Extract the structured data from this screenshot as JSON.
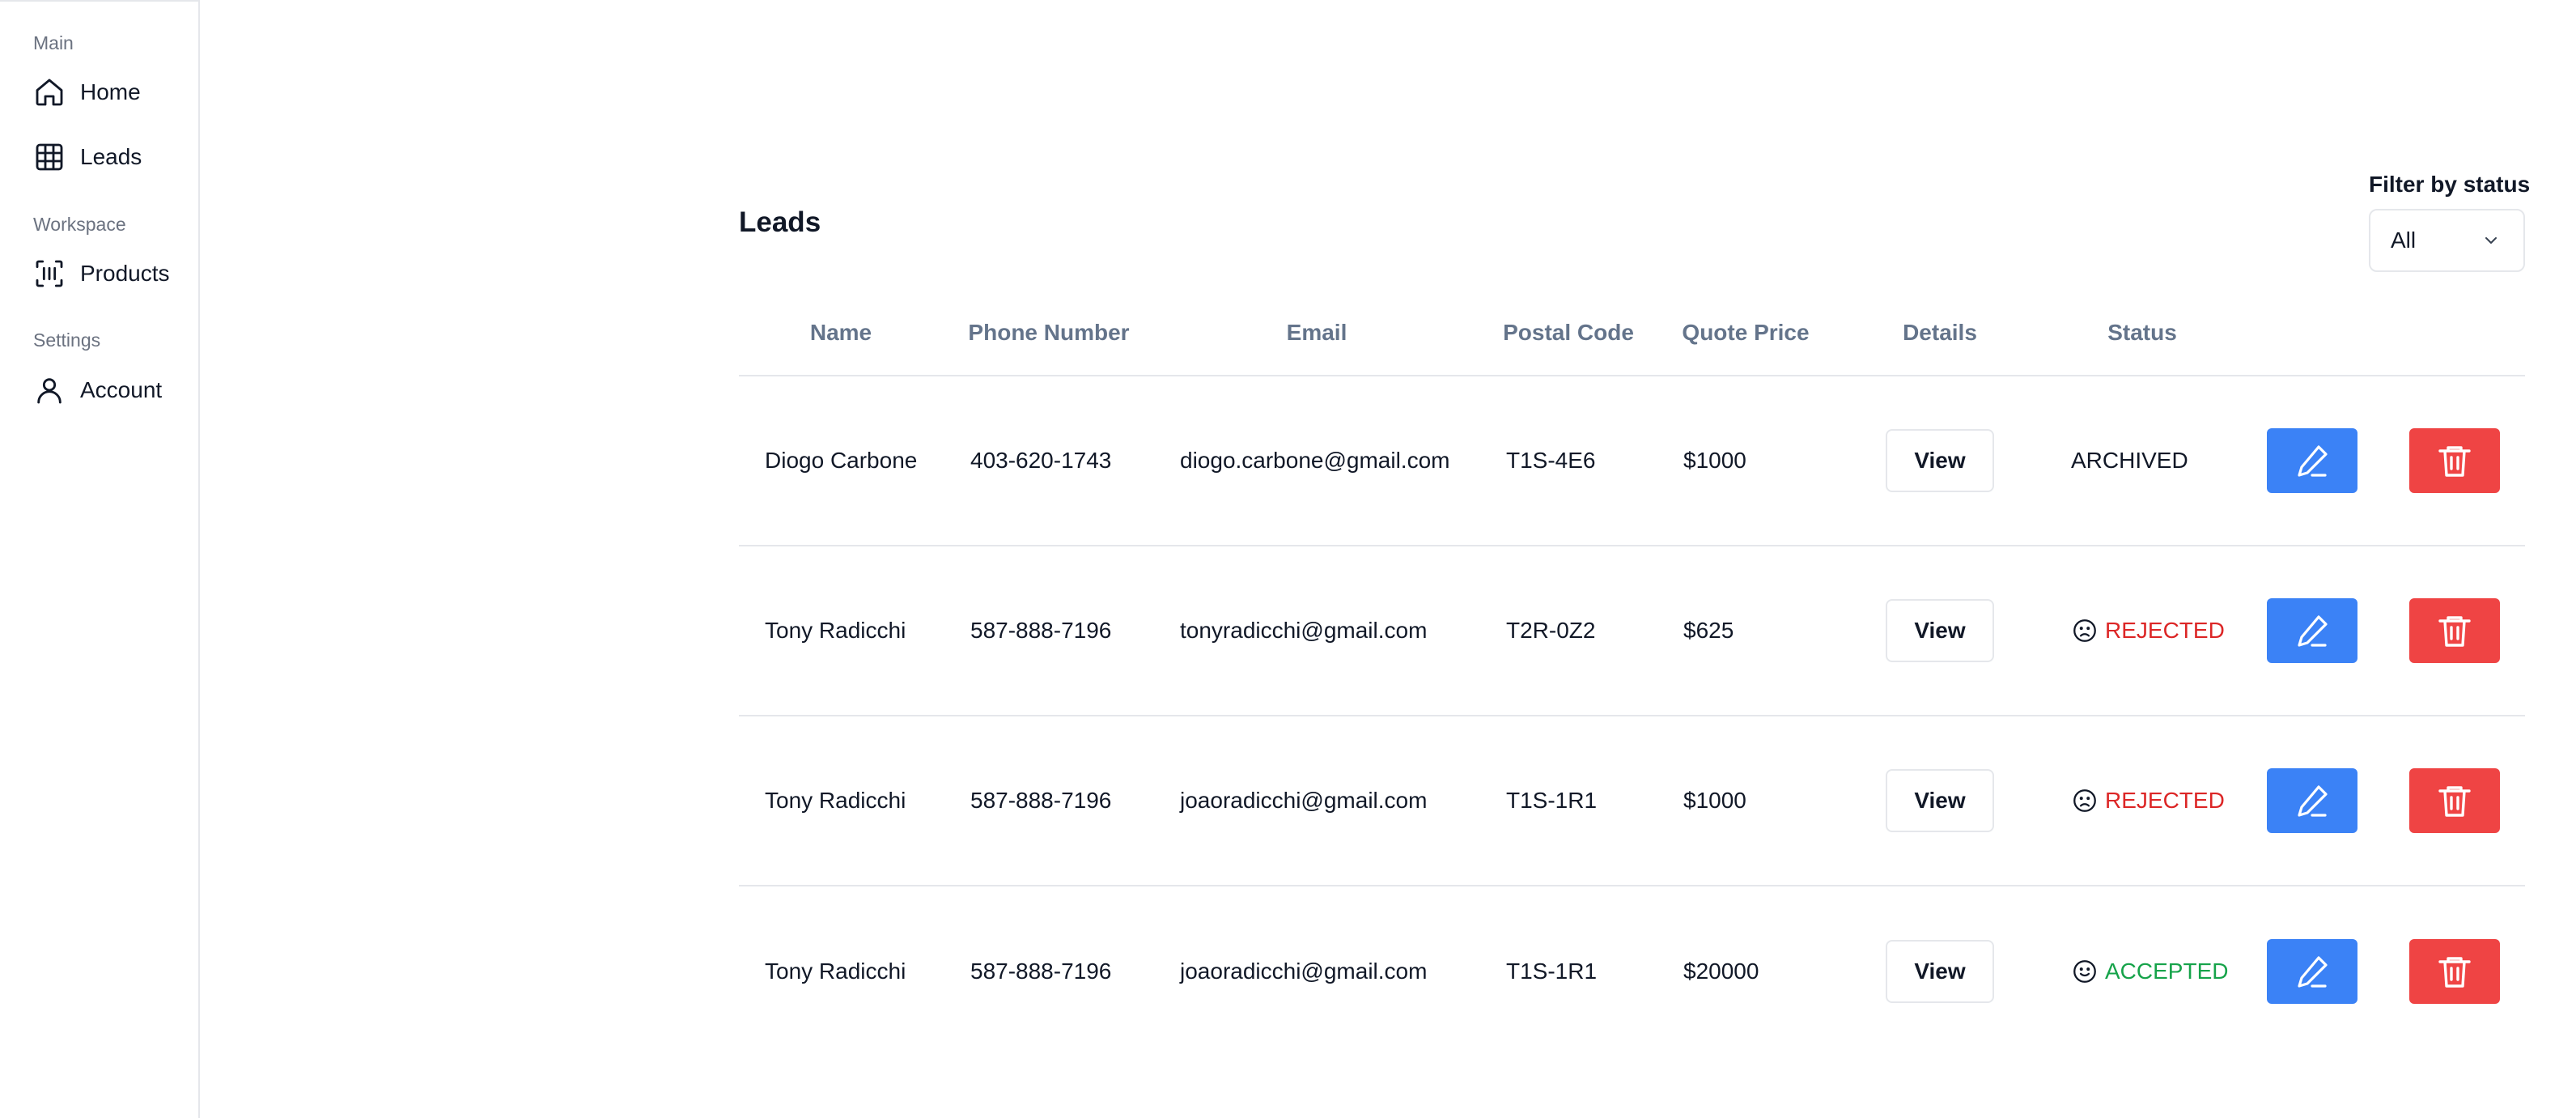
{
  "sidebar": {
    "groups": [
      {
        "label": "Main",
        "items": [
          {
            "label": "Home",
            "icon": "home-icon"
          },
          {
            "label": "Leads",
            "icon": "grid-icon"
          }
        ]
      },
      {
        "label": "Workspace",
        "items": [
          {
            "label": "Products",
            "icon": "barcode-scan-icon"
          }
        ]
      },
      {
        "label": "Settings",
        "items": [
          {
            "label": "Account",
            "icon": "user-icon"
          }
        ]
      }
    ]
  },
  "page": {
    "title": "Leads",
    "filter": {
      "label": "Filter by status",
      "value": "All"
    }
  },
  "table": {
    "columns": [
      "Name",
      "Phone Number",
      "Email",
      "Postal Code",
      "Quote Price",
      "Details",
      "Status"
    ],
    "view_label": "View",
    "rows": [
      {
        "name": "Diogo Carbone",
        "phone": "403-620-1743",
        "email": "diogo.carbone@gmail.com",
        "postal": "T1S-4E6",
        "price": "$1000",
        "status": "ARCHIVED",
        "status_icon": "",
        "status_color": "#111827"
      },
      {
        "name": "Tony Radicchi",
        "phone": "587-888-7196",
        "email": "tonyradicchi@gmail.com",
        "postal": "T2R-0Z2",
        "price": "$625",
        "status": "REJECTED",
        "status_icon": "sad-face-icon",
        "status_color": "#dc2626"
      },
      {
        "name": "Tony Radicchi",
        "phone": "587-888-7196",
        "email": "joaoradicchi@gmail.com",
        "postal": "T1S-1R1",
        "price": "$1000",
        "status": "REJECTED",
        "status_icon": "sad-face-icon",
        "status_color": "#dc2626"
      },
      {
        "name": "Tony Radicchi",
        "phone": "587-888-7196",
        "email": "joaoradicchi@gmail.com",
        "postal": "T1S-1R1",
        "price": "$20000",
        "status": "ACCEPTED",
        "status_icon": "happy-face-icon",
        "status_color": "#16a34a"
      }
    ]
  },
  "colors": {
    "edit": "#3b82f6",
    "delete": "#ef4444",
    "accepted": "#16a34a",
    "rejected": "#dc2626"
  }
}
